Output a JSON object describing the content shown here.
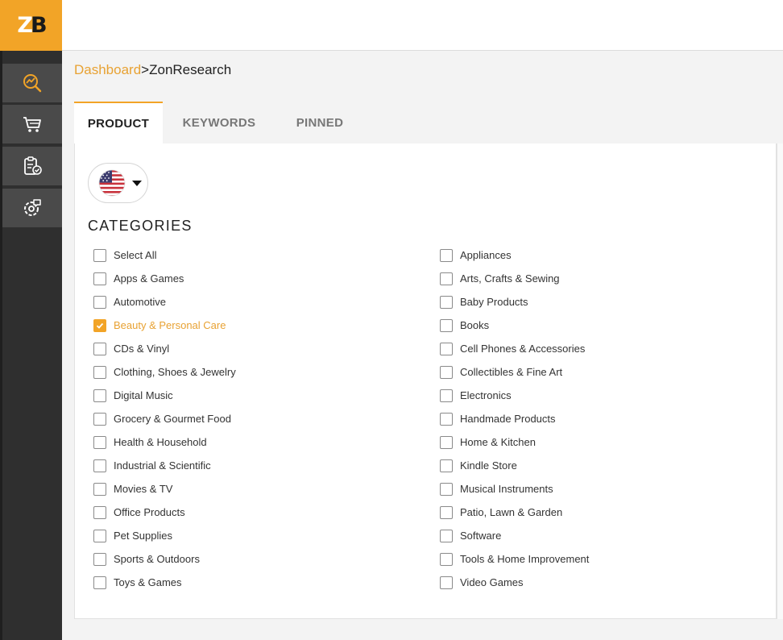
{
  "brand": {
    "logo_left": "Z",
    "logo_right": "B"
  },
  "sidebar": {
    "items": [
      {
        "icon": "research-chart-icon"
      },
      {
        "icon": "cart-icon"
      },
      {
        "icon": "clipboard-check-icon"
      },
      {
        "icon": "settings-chat-icon"
      }
    ]
  },
  "breadcrumb": {
    "parent": "Dashboard",
    "separator": ">",
    "current": "ZonResearch"
  },
  "tabs": [
    {
      "label": "PRODUCT",
      "active": true
    },
    {
      "label": "KEYWORDS",
      "active": false
    },
    {
      "label": "PINNED",
      "active": false
    }
  ],
  "marketplace": {
    "selected_flag_icon": "us-flag-icon"
  },
  "categories": {
    "title": "CATEGORIES",
    "left": [
      {
        "label": "Select All",
        "checked": false
      },
      {
        "label": "Apps & Games",
        "checked": false
      },
      {
        "label": "Automotive",
        "checked": false
      },
      {
        "label": "Beauty & Personal Care",
        "checked": true
      },
      {
        "label": "CDs & Vinyl",
        "checked": false
      },
      {
        "label": "Clothing, Shoes & Jewelry",
        "checked": false
      },
      {
        "label": "Digital Music",
        "checked": false
      },
      {
        "label": "Grocery & Gourmet Food",
        "checked": false
      },
      {
        "label": "Health & Household",
        "checked": false
      },
      {
        "label": "Industrial & Scientific",
        "checked": false
      },
      {
        "label": "Movies & TV",
        "checked": false
      },
      {
        "label": "Office Products",
        "checked": false
      },
      {
        "label": "Pet Supplies",
        "checked": false
      },
      {
        "label": "Sports & Outdoors",
        "checked": false
      },
      {
        "label": "Toys & Games",
        "checked": false
      }
    ],
    "right": [
      {
        "label": "Appliances",
        "checked": false
      },
      {
        "label": "Arts, Crafts & Sewing",
        "checked": false
      },
      {
        "label": "Baby Products",
        "checked": false
      },
      {
        "label": "Books",
        "checked": false
      },
      {
        "label": "Cell Phones & Accessories",
        "checked": false
      },
      {
        "label": "Collectibles & Fine Art",
        "checked": false
      },
      {
        "label": "Electronics",
        "checked": false
      },
      {
        "label": "Handmade Products",
        "checked": false
      },
      {
        "label": "Home & Kitchen",
        "checked": false
      },
      {
        "label": "Kindle Store",
        "checked": false
      },
      {
        "label": "Musical Instruments",
        "checked": false
      },
      {
        "label": "Patio, Lawn & Garden",
        "checked": false
      },
      {
        "label": "Software",
        "checked": false
      },
      {
        "label": "Tools & Home Improvement",
        "checked": false
      },
      {
        "label": "Video Games",
        "checked": false
      }
    ]
  },
  "colors": {
    "accent": "#f2a427",
    "sidebar": "#2f2f2f",
    "sidebar_button": "#4a4a4a"
  }
}
